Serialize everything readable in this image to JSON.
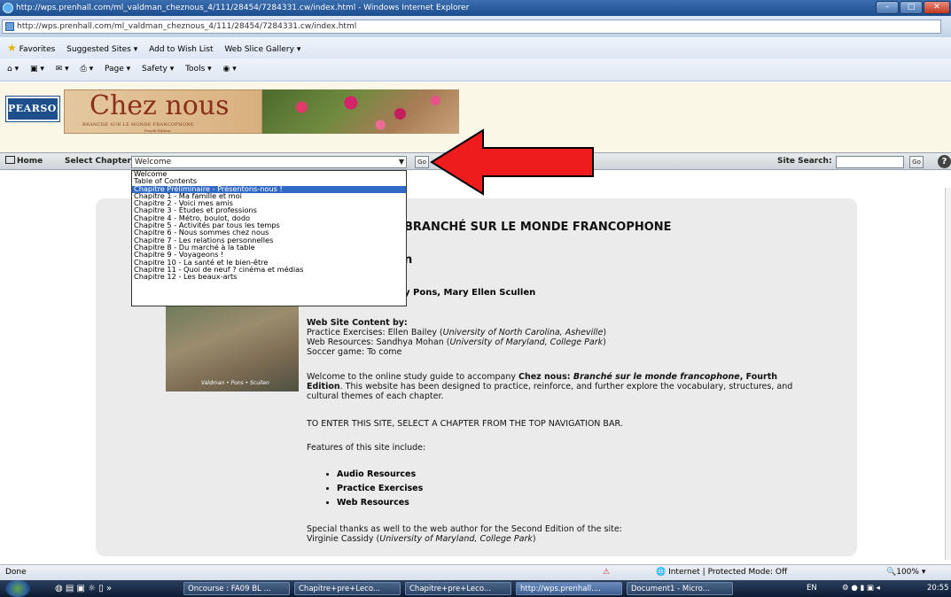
{
  "window": {
    "title": "http://wps.prenhall.com/ml_valdman_cheznous_4/111/28454/7284331.cw/index.html - Windows Internet Explorer",
    "address": "http://wps.prenhall.com/ml_valdman_cheznous_4/111/28454/7284331.cw/index.html"
  },
  "favorites_bar": {
    "favorites": "Favorites",
    "suggested": "Suggested Sites ▾",
    "wishlist": "Add to Wish List",
    "slice": "Web Slice Gallery ▾"
  },
  "command_bar": {
    "page": "Page ▾",
    "safety": "Safety ▾",
    "tools": "Tools ▾"
  },
  "header": {
    "publisher": "PEARSON",
    "logo_title": "Chez nous",
    "logo_subtitle": "BRANCHÉ SUR LE MONDE FRANCOPHONE",
    "logo_edition": "Fourth Edition"
  },
  "nav": {
    "home": "Home",
    "select_label": "Select Chapter:",
    "selected": "Welcome",
    "go": "Go",
    "search_label": "Site Search:",
    "help": "?"
  },
  "dropdown": {
    "options": [
      "Welcome",
      "Table of Contents",
      "Chapitre Préliminaire - Présentons-nous !",
      "Chapitre 1 - Ma famille et moi",
      "Chapitre 2 - Voici mes amis",
      "Chapitre 3 - Études et professions",
      "Chapitre 4 - Métro, boulot, dodo",
      "Chapitre 5 - Activités par tous les temps",
      "Chapitre 6 - Nous sommes chez nous",
      "Chapitre 7 - Les relations personnelles",
      "Chapitre 8 - Du marché à la table",
      "Chapitre 9 - Voyageons !",
      "Chapitre 10 - La santé et le bien-être",
      "Chapitre 11 - Quoi de neuf ? cinéma et médias",
      "Chapitre 12 - Les beaux-arts"
    ],
    "highlighted_index": 2
  },
  "content": {
    "heading1": "BRANCHÉ SUR LE MONDE FRANCOPHONE",
    "heading2": "n",
    "authors": "y Pons, Mary Ellen Scullen",
    "book_caption": "Valdman • Pons • Scullen",
    "web_content_title": "Web Site Content by:",
    "line1_prefix": "Practice Exercises: Ellen Bailey (",
    "line1_inst": "University of North Carolina, Asheville",
    "line1_suffix": ")",
    "line2_prefix": "Web Resources: Sandhya Mohan (",
    "line2_inst": "University of Maryland, College Park",
    "line2_suffix": ")",
    "line3": "Soccer game: To come",
    "welcome_1": "Welcome to the online study guide to accompany ",
    "welcome_b1": "Chez nous: ",
    "welcome_i1": "Branché sur le monde francophone",
    "welcome_b2": ", Fourth Edition",
    "welcome_2": ". This website has been designed to practice, reinforce, and further explore the vocabulary, structures, and cultural themes of each chapter.",
    "enter": "TO ENTER THIS SITE, SELECT A CHAPTER FROM THE TOP NAVIGATION BAR.",
    "features_intro": "Features of this site include:",
    "features": [
      "Audio Resources",
      "Practice Exercises",
      "Web Resources"
    ],
    "thanks": "Special thanks as well to the web author for the Second Edition of the site:",
    "thanks_name": "Virginie Cassidy (",
    "thanks_inst": "University of Maryland, College Park",
    "thanks_end": ")"
  },
  "status": {
    "left": "Done",
    "zone": "Internet | Protected Mode: Off",
    "zoom": "100%"
  },
  "taskbar": {
    "items": [
      "Oncourse : FA09 BL ...",
      "Chapitre+pre+Leco...",
      "Chapitre+pre+Leco...",
      "http://wps.prenhall....",
      "Document1 - Micro..."
    ],
    "lang": "EN",
    "time": "20:55"
  },
  "colors": {
    "arrow": "#ee1c1c",
    "highlight": "#3169c6",
    "panel": "#ebebeb"
  }
}
